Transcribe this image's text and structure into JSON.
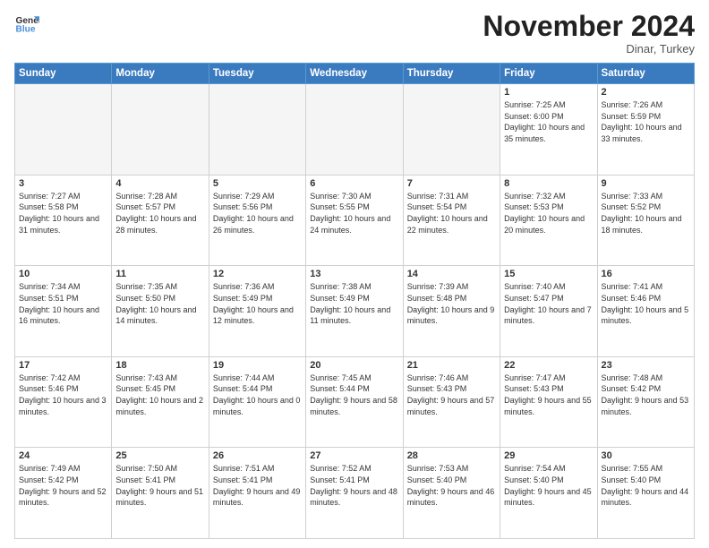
{
  "header": {
    "logo_line1": "General",
    "logo_line2": "Blue",
    "month": "November 2024",
    "location": "Dinar, Turkey"
  },
  "weekdays": [
    "Sunday",
    "Monday",
    "Tuesday",
    "Wednesday",
    "Thursday",
    "Friday",
    "Saturday"
  ],
  "weeks": [
    [
      {
        "day": "",
        "info": ""
      },
      {
        "day": "",
        "info": ""
      },
      {
        "day": "",
        "info": ""
      },
      {
        "day": "",
        "info": ""
      },
      {
        "day": "",
        "info": ""
      },
      {
        "day": "1",
        "info": "Sunrise: 7:25 AM\nSunset: 6:00 PM\nDaylight: 10 hours and 35 minutes."
      },
      {
        "day": "2",
        "info": "Sunrise: 7:26 AM\nSunset: 5:59 PM\nDaylight: 10 hours and 33 minutes."
      }
    ],
    [
      {
        "day": "3",
        "info": "Sunrise: 7:27 AM\nSunset: 5:58 PM\nDaylight: 10 hours and 31 minutes."
      },
      {
        "day": "4",
        "info": "Sunrise: 7:28 AM\nSunset: 5:57 PM\nDaylight: 10 hours and 28 minutes."
      },
      {
        "day": "5",
        "info": "Sunrise: 7:29 AM\nSunset: 5:56 PM\nDaylight: 10 hours and 26 minutes."
      },
      {
        "day": "6",
        "info": "Sunrise: 7:30 AM\nSunset: 5:55 PM\nDaylight: 10 hours and 24 minutes."
      },
      {
        "day": "7",
        "info": "Sunrise: 7:31 AM\nSunset: 5:54 PM\nDaylight: 10 hours and 22 minutes."
      },
      {
        "day": "8",
        "info": "Sunrise: 7:32 AM\nSunset: 5:53 PM\nDaylight: 10 hours and 20 minutes."
      },
      {
        "day": "9",
        "info": "Sunrise: 7:33 AM\nSunset: 5:52 PM\nDaylight: 10 hours and 18 minutes."
      }
    ],
    [
      {
        "day": "10",
        "info": "Sunrise: 7:34 AM\nSunset: 5:51 PM\nDaylight: 10 hours and 16 minutes."
      },
      {
        "day": "11",
        "info": "Sunrise: 7:35 AM\nSunset: 5:50 PM\nDaylight: 10 hours and 14 minutes."
      },
      {
        "day": "12",
        "info": "Sunrise: 7:36 AM\nSunset: 5:49 PM\nDaylight: 10 hours and 12 minutes."
      },
      {
        "day": "13",
        "info": "Sunrise: 7:38 AM\nSunset: 5:49 PM\nDaylight: 10 hours and 11 minutes."
      },
      {
        "day": "14",
        "info": "Sunrise: 7:39 AM\nSunset: 5:48 PM\nDaylight: 10 hours and 9 minutes."
      },
      {
        "day": "15",
        "info": "Sunrise: 7:40 AM\nSunset: 5:47 PM\nDaylight: 10 hours and 7 minutes."
      },
      {
        "day": "16",
        "info": "Sunrise: 7:41 AM\nSunset: 5:46 PM\nDaylight: 10 hours and 5 minutes."
      }
    ],
    [
      {
        "day": "17",
        "info": "Sunrise: 7:42 AM\nSunset: 5:46 PM\nDaylight: 10 hours and 3 minutes."
      },
      {
        "day": "18",
        "info": "Sunrise: 7:43 AM\nSunset: 5:45 PM\nDaylight: 10 hours and 2 minutes."
      },
      {
        "day": "19",
        "info": "Sunrise: 7:44 AM\nSunset: 5:44 PM\nDaylight: 10 hours and 0 minutes."
      },
      {
        "day": "20",
        "info": "Sunrise: 7:45 AM\nSunset: 5:44 PM\nDaylight: 9 hours and 58 minutes."
      },
      {
        "day": "21",
        "info": "Sunrise: 7:46 AM\nSunset: 5:43 PM\nDaylight: 9 hours and 57 minutes."
      },
      {
        "day": "22",
        "info": "Sunrise: 7:47 AM\nSunset: 5:43 PM\nDaylight: 9 hours and 55 minutes."
      },
      {
        "day": "23",
        "info": "Sunrise: 7:48 AM\nSunset: 5:42 PM\nDaylight: 9 hours and 53 minutes."
      }
    ],
    [
      {
        "day": "24",
        "info": "Sunrise: 7:49 AM\nSunset: 5:42 PM\nDaylight: 9 hours and 52 minutes."
      },
      {
        "day": "25",
        "info": "Sunrise: 7:50 AM\nSunset: 5:41 PM\nDaylight: 9 hours and 51 minutes."
      },
      {
        "day": "26",
        "info": "Sunrise: 7:51 AM\nSunset: 5:41 PM\nDaylight: 9 hours and 49 minutes."
      },
      {
        "day": "27",
        "info": "Sunrise: 7:52 AM\nSunset: 5:41 PM\nDaylight: 9 hours and 48 minutes."
      },
      {
        "day": "28",
        "info": "Sunrise: 7:53 AM\nSunset: 5:40 PM\nDaylight: 9 hours and 46 minutes."
      },
      {
        "day": "29",
        "info": "Sunrise: 7:54 AM\nSunset: 5:40 PM\nDaylight: 9 hours and 45 minutes."
      },
      {
        "day": "30",
        "info": "Sunrise: 7:55 AM\nSunset: 5:40 PM\nDaylight: 9 hours and 44 minutes."
      }
    ]
  ]
}
